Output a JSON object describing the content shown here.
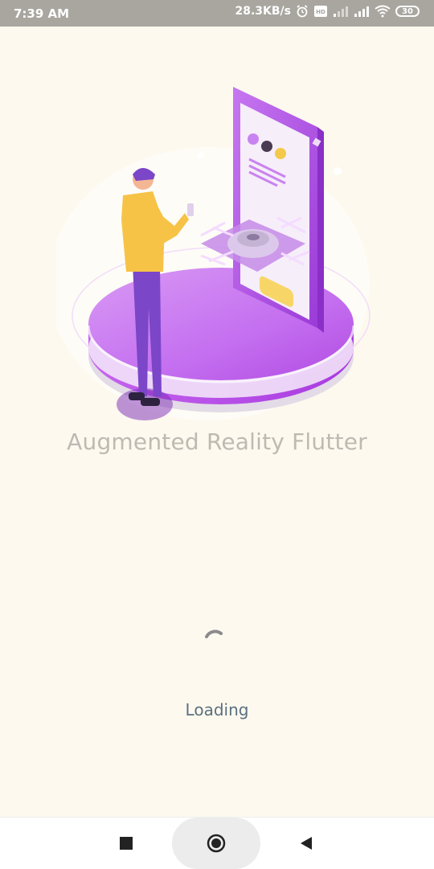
{
  "status_bar": {
    "time": "7:39 AM",
    "net_speed": "28.3KB/s",
    "battery": "30",
    "icons": [
      "alarm-icon",
      "volte-icon",
      "signal-icon",
      "signal-icon",
      "wifi-icon",
      "battery-icon"
    ]
  },
  "splash": {
    "title": "Augmented Reality Flutter",
    "loading_label": "Loading",
    "illustration_icon": "ar-person-phone-illustration"
  },
  "nav_bar": {
    "icons": [
      "recents-square-icon",
      "home-circle-icon",
      "back-triangle-icon"
    ]
  },
  "colors": {
    "background": "#fdf9ee",
    "status_bar": "#a9a6a0",
    "title": "#bdbab4",
    "loading": "#5a7080",
    "accent_purple": "#b55ee0"
  }
}
